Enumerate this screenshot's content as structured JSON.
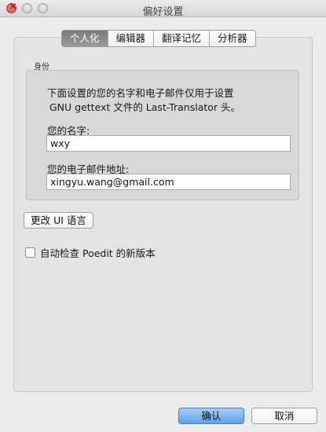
{
  "window": {
    "title": "偏好设置"
  },
  "tabs": [
    {
      "label": "个人化",
      "active": true
    },
    {
      "label": "编辑器",
      "active": false
    },
    {
      "label": "翻译记忆",
      "active": false
    },
    {
      "label": "分析器",
      "active": false
    }
  ],
  "identity": {
    "group_label": "身份",
    "description_line1": "下面设置的您的名字和电子邮件仅用于设置",
    "description_line2": "GNU gettext 文件的 Last-Translator 头。",
    "name_label": "您的名字:",
    "name_value": "wxy",
    "email_label": "您的电子邮件地址:",
    "email_value": "xingyu.wang@gmail.com"
  },
  "change_ui_language_label": "更改 UI 语言",
  "auto_check": {
    "label": "自动检查 Poedit 的新版本",
    "checked": false
  },
  "footer": {
    "ok_label": "确认",
    "cancel_label": "取消"
  },
  "colors": {
    "primary_button": "#5ea2ef",
    "active_tab": "#7a7a7a"
  }
}
